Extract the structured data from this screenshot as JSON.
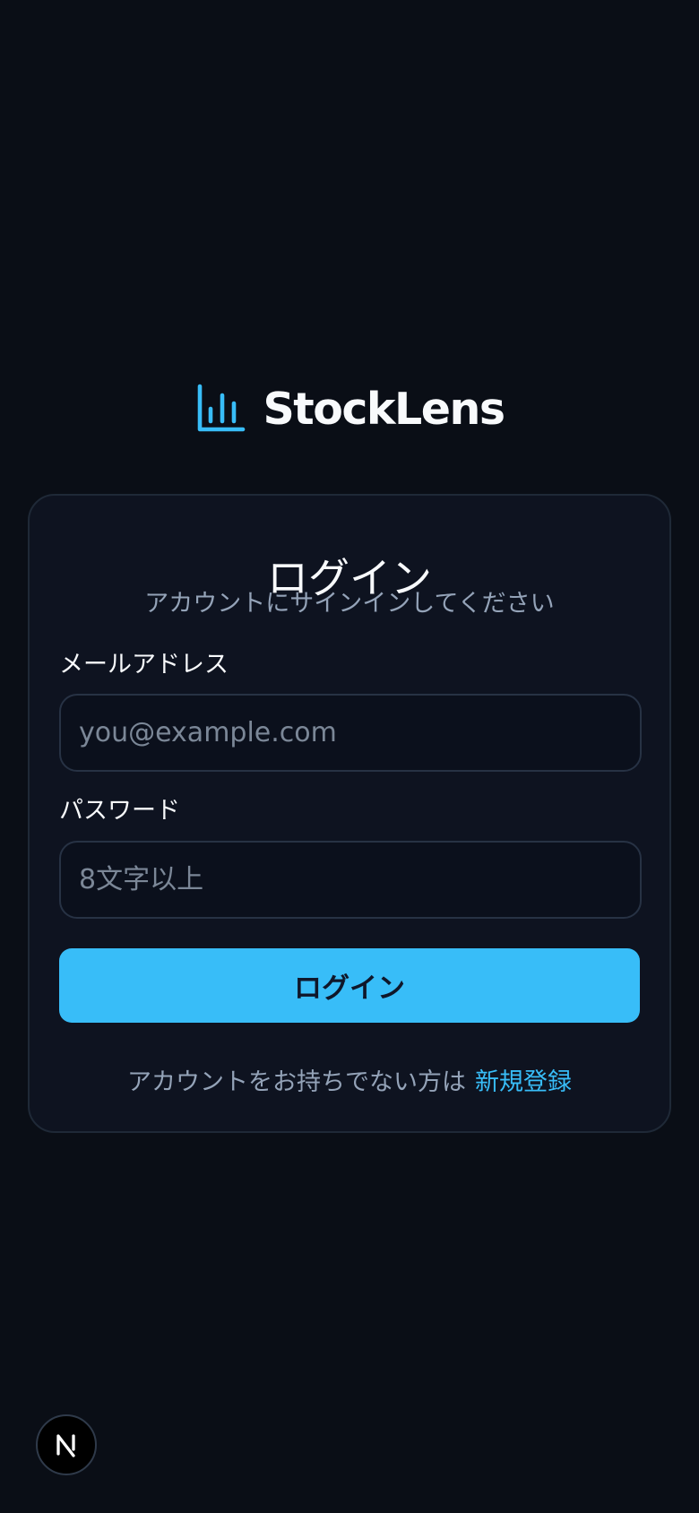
{
  "brand": {
    "name": "StockLens",
    "icon": "bar-chart-icon",
    "accent_color": "#38bdf8"
  },
  "login_card": {
    "title": "ログイン",
    "subtitle": "アカウントにサインインしてください",
    "email": {
      "label": "メールアドレス",
      "value": "",
      "placeholder": "you@example.com"
    },
    "password": {
      "label": "パスワード",
      "value": "",
      "placeholder": "8文字以上"
    },
    "submit_label": "ログイン",
    "footer": {
      "prompt": "アカウントをお持ちでない方は",
      "link_label": "新規登録"
    }
  },
  "devtools": {
    "icon": "next-logo-icon"
  },
  "colors": {
    "background": "#0a0e16",
    "card": "#0e1320",
    "primary_button": "#38bdf8",
    "muted_text": "#94a3b8"
  }
}
